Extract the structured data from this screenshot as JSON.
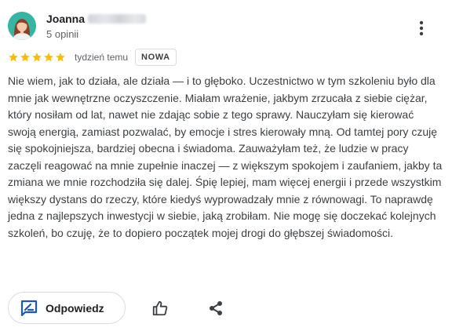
{
  "reviewer": {
    "first_name": "Joanna",
    "review_count_label": "5 opinii",
    "avatar_bg": "#36b5a2"
  },
  "review": {
    "rating": 5,
    "max_rating": 5,
    "star_color": "#fbbc04",
    "time_ago": "tydzień temu",
    "badge": "NOWA",
    "text": "Nie wiem, jak to działa, ale działa — i to głęboko. Uczestnictwo w tym szkoleniu było dla mnie jak wewnętrzne oczyszczenie. Miałam wrażenie, jakbym zrzucała z siebie ciężar, który nosiłam od lat, nawet nie zdając sobie z tego sprawy. Nauczyłam się kierować swoją energią, zamiast pozwalać, by emocje i stres kierowały mną. Od tamtej pory czuję się spokojniejsza, bardziej obecna i świadoma. Zauważyłam też, że ludzie w pracy zaczęli reagować na mnie zupełnie inaczej — z większym spokojem i zaufaniem, jakby ta zmiana we mnie rozchodziła się dalej. Śpię lepiej, mam więcej energii i przede wszystkim większy dystans do rzeczy, które kiedyś wyprowadzały mnie z równowagi. To naprawdę jedna z najlepszych inwestycji w siebie, jaką zrobiłam. Nie mogę się doczekać kolejnych szkoleń, bo czuję, że to dopiero początek mojej drogi do głębszej świadomości."
  },
  "actions": {
    "reply_label": "Odpowiedz",
    "accent_color": "#1a56c9",
    "icons": [
      "reply-icon",
      "thumbs-up-icon",
      "share-icon",
      "more-vert-icon"
    ]
  }
}
